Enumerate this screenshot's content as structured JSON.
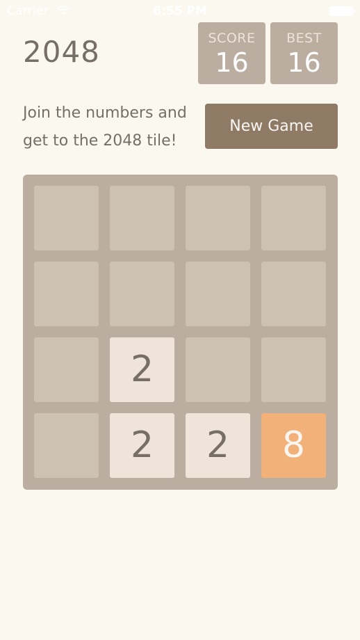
{
  "status_bar": {
    "carrier": "Carrier",
    "time": "6:55 PM",
    "wifi_icon": "wifi-icon",
    "battery_icon": "battery-icon"
  },
  "header": {
    "title": "2048",
    "score_label": "SCORE",
    "score_value": "16",
    "best_label": "BEST",
    "best_value": "16"
  },
  "intro": {
    "text": "Join the numbers and get to the 2048 tile!",
    "new_game_label": "New Game"
  },
  "colors": {
    "background": "#faf8ef",
    "board": "#bbada0",
    "empty_cell": "#cdc1b4",
    "tile_2": "#eee4da",
    "tile_8": "#f2b179",
    "button": "#8f7a66",
    "text": "#776e65"
  },
  "board": {
    "rows": [
      [
        "",
        "",
        "",
        ""
      ],
      [
        "",
        "",
        "",
        ""
      ],
      [
        "",
        "2",
        "",
        ""
      ],
      [
        "",
        "2",
        "2",
        "8"
      ]
    ]
  }
}
